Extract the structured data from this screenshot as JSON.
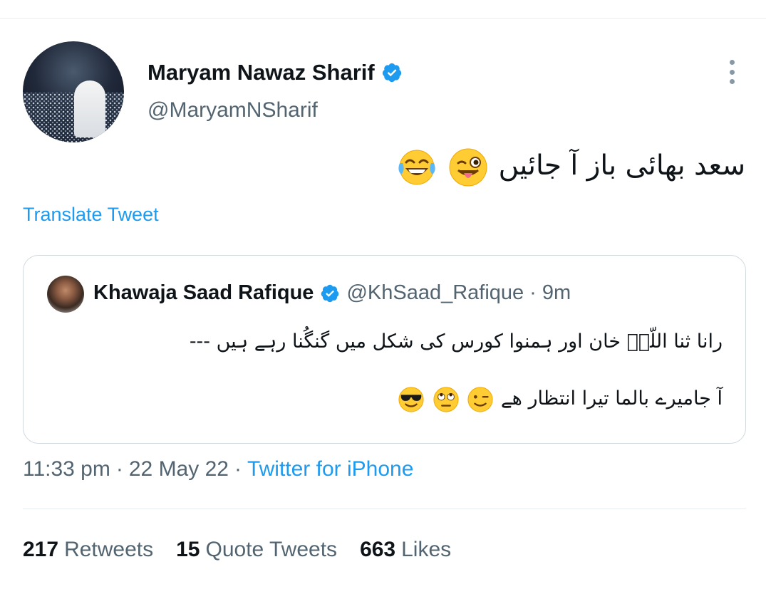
{
  "tweet": {
    "author": {
      "display_name": "Maryam Nawaz Sharif",
      "handle": "@MaryamNSharif",
      "verified": true
    },
    "text": "سعد بھائی باز آ جائیں",
    "emojis": [
      "winking-face-with-tongue",
      "face-with-tears-of-joy"
    ],
    "translate_label": "Translate Tweet",
    "timestamp": "11:33 pm",
    "date": "22 May 22",
    "source": "Twitter for iPhone",
    "separator": "·"
  },
  "quoted_tweet": {
    "author": {
      "display_name": "Khawaja Saad Rafique",
      "handle": "@KhSaad_Rafique",
      "verified": true
    },
    "time_ago": "9m",
    "separator": "·",
    "line1": "رانا ثنا اللّہؑ خان اور ہمنوا کورس کی شکل میں گنگُنا رہے ہیں ---",
    "line2": "آ جامیرے بالما تیرا انتظار ھے",
    "line2_emojis": [
      "winking-face",
      "face-with-rolling-eyes",
      "smiling-face-with-sunglasses"
    ]
  },
  "stats": {
    "retweets": {
      "count": "217",
      "label": "Retweets"
    },
    "quote_tweets": {
      "count": "15",
      "label": "Quote Tweets"
    },
    "likes": {
      "count": "663",
      "label": "Likes"
    }
  },
  "colors": {
    "accent": "#1d9bf0",
    "secondary_text": "#536471",
    "border": "#cfd9de"
  }
}
